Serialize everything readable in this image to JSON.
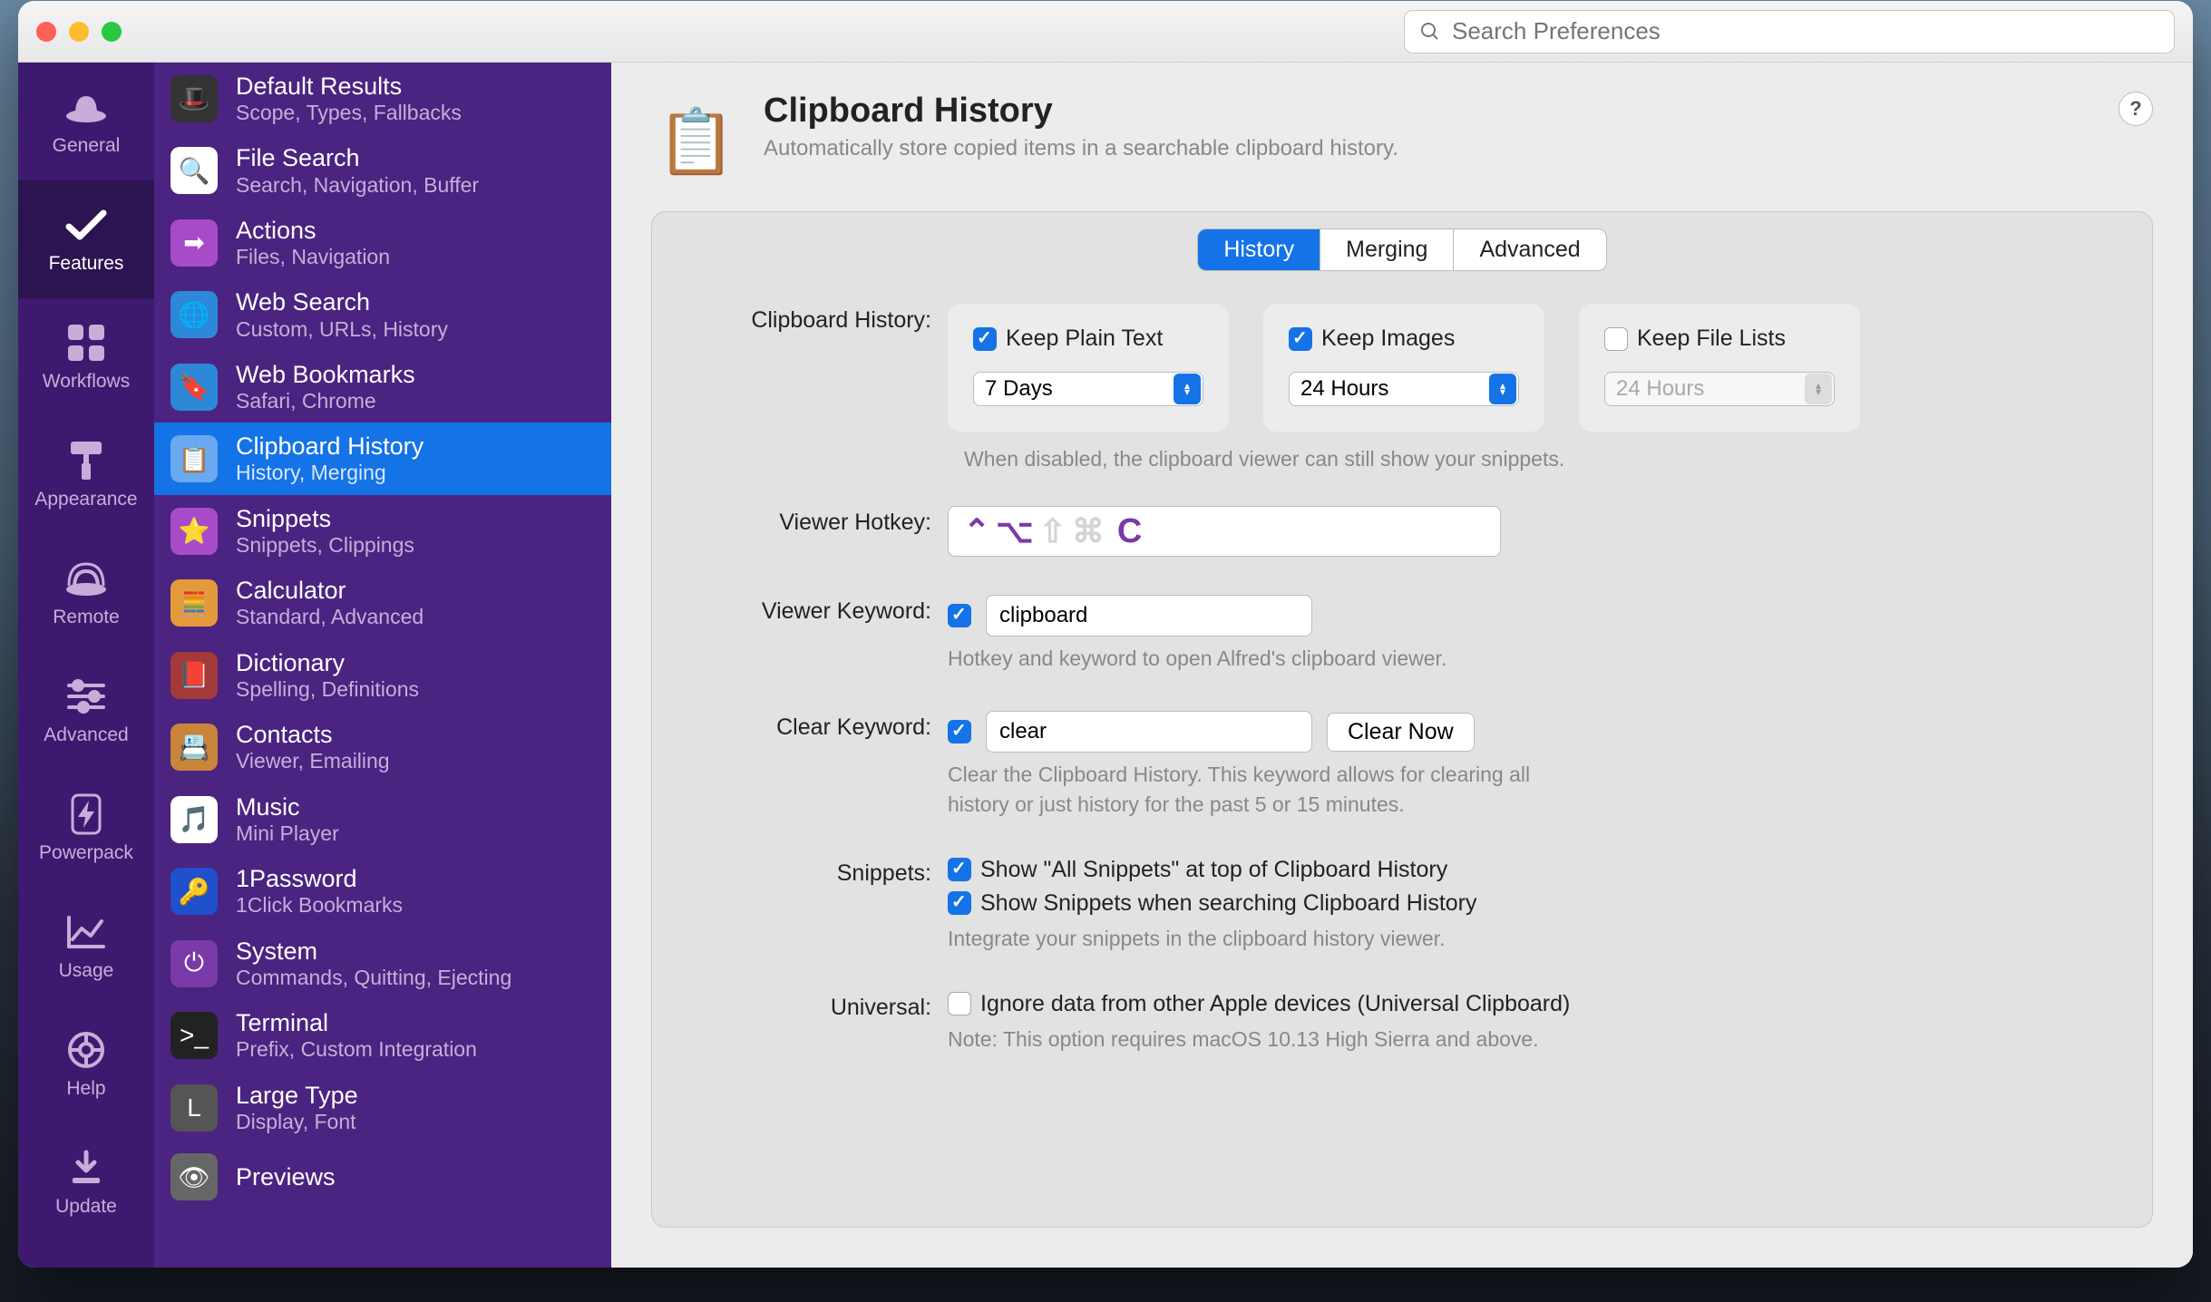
{
  "search": {
    "placeholder": "Search Preferences"
  },
  "rail": [
    {
      "label": "General",
      "icon": "hat"
    },
    {
      "label": "Features",
      "icon": "check",
      "active": true
    },
    {
      "label": "Workflows",
      "icon": "grid"
    },
    {
      "label": "Appearance",
      "icon": "roller"
    },
    {
      "label": "Remote",
      "icon": "remote"
    },
    {
      "label": "Advanced",
      "icon": "sliders"
    },
    {
      "label": "Powerpack",
      "icon": "bolt"
    },
    {
      "label": "Usage",
      "icon": "chart"
    },
    {
      "label": "Help",
      "icon": "lifebuoy"
    },
    {
      "label": "Update",
      "icon": "download"
    }
  ],
  "features": [
    {
      "title": "Default Results",
      "sub": "Scope, Types, Fallbacks",
      "iconColor": "#333",
      "emoji": "🎩"
    },
    {
      "title": "File Search",
      "sub": "Search, Navigation, Buffer",
      "iconColor": "#fff",
      "emoji": "🔍"
    },
    {
      "title": "Actions",
      "sub": "Files, Navigation",
      "iconColor": "#a84bc9",
      "emoji": "➡"
    },
    {
      "title": "Web Search",
      "sub": "Custom, URLs, History",
      "iconColor": "#2e88d8",
      "emoji": "🌐"
    },
    {
      "title": "Web Bookmarks",
      "sub": "Safari, Chrome",
      "iconColor": "#2e88d8",
      "emoji": "🔖"
    },
    {
      "title": "Clipboard History",
      "sub": "History, Merging",
      "iconColor": "#6aa8f0",
      "emoji": "📋",
      "selected": true
    },
    {
      "title": "Snippets",
      "sub": "Snippets, Clippings",
      "iconColor": "#a84bc9",
      "emoji": "⭐"
    },
    {
      "title": "Calculator",
      "sub": "Standard, Advanced",
      "iconColor": "#e59a3a",
      "emoji": "🧮"
    },
    {
      "title": "Dictionary",
      "sub": "Spelling, Definitions",
      "iconColor": "#a33a3a",
      "emoji": "📕"
    },
    {
      "title": "Contacts",
      "sub": "Viewer, Emailing",
      "iconColor": "#c9853a",
      "emoji": "📇"
    },
    {
      "title": "Music",
      "sub": "Mini Player",
      "iconColor": "#fff",
      "emoji": "🎵"
    },
    {
      "title": "1Password",
      "sub": "1Click Bookmarks",
      "iconColor": "#2050cc",
      "emoji": "🔑"
    },
    {
      "title": "System",
      "sub": "Commands, Quitting, Ejecting",
      "iconColor": "#7a3aa8",
      "emoji": "⏻"
    },
    {
      "title": "Terminal",
      "sub": "Prefix, Custom Integration",
      "iconColor": "#222",
      "emoji": ">_"
    },
    {
      "title": "Large Type",
      "sub": "Display, Font",
      "iconColor": "#555",
      "emoji": "L"
    },
    {
      "title": "Previews",
      "sub": "",
      "iconColor": "#666",
      "emoji": "👁"
    }
  ],
  "page": {
    "title": "Clipboard History",
    "subtitle": "Automatically store copied items in a searchable clipboard history.",
    "help": "?"
  },
  "tabs": [
    {
      "label": "History",
      "active": true
    },
    {
      "label": "Merging"
    },
    {
      "label": "Advanced"
    }
  ],
  "labels": {
    "clipboard_history": "Clipboard History:",
    "viewer_hotkey": "Viewer Hotkey:",
    "viewer_keyword": "Viewer Keyword:",
    "clear_keyword": "Clear Keyword:",
    "snippets": "Snippets:",
    "universal": "Universal:"
  },
  "cards": {
    "plain": {
      "label": "Keep Plain Text",
      "checked": true,
      "value": "7 Days"
    },
    "images": {
      "label": "Keep Images",
      "checked": true,
      "value": "24 Hours"
    },
    "files": {
      "label": "Keep File Lists",
      "checked": false,
      "value": "24 Hours"
    }
  },
  "hints": {
    "disabled": "When disabled, the clipboard viewer can still show your snippets.",
    "hotkey_kw": "Hotkey and keyword to open Alfred's clipboard viewer.",
    "clear": "Clear the Clipboard History. This keyword allows for clearing all history or just history for the past 5 or 15 minutes.",
    "snippets": "Integrate your snippets in the clipboard history viewer.",
    "universal": "Note: This option requires macOS 10.13 High Sierra and above."
  },
  "hotkey": {
    "ctrl": "⌃",
    "opt": "⌥",
    "shift": "⇧",
    "cmd": "⌘",
    "key": "C",
    "active": [
      "ctrl",
      "opt"
    ]
  },
  "viewer_keyword": {
    "checked": true,
    "value": "clipboard"
  },
  "clear_keyword": {
    "checked": true,
    "value": "clear",
    "button": "Clear Now"
  },
  "snippet_opts": {
    "all": {
      "checked": true,
      "label": "Show \"All Snippets\" at top of Clipboard History"
    },
    "search": {
      "checked": true,
      "label": "Show Snippets when searching Clipboard History"
    }
  },
  "universal": {
    "checked": false,
    "label": "Ignore data from other Apple devices (Universal Clipboard)"
  }
}
